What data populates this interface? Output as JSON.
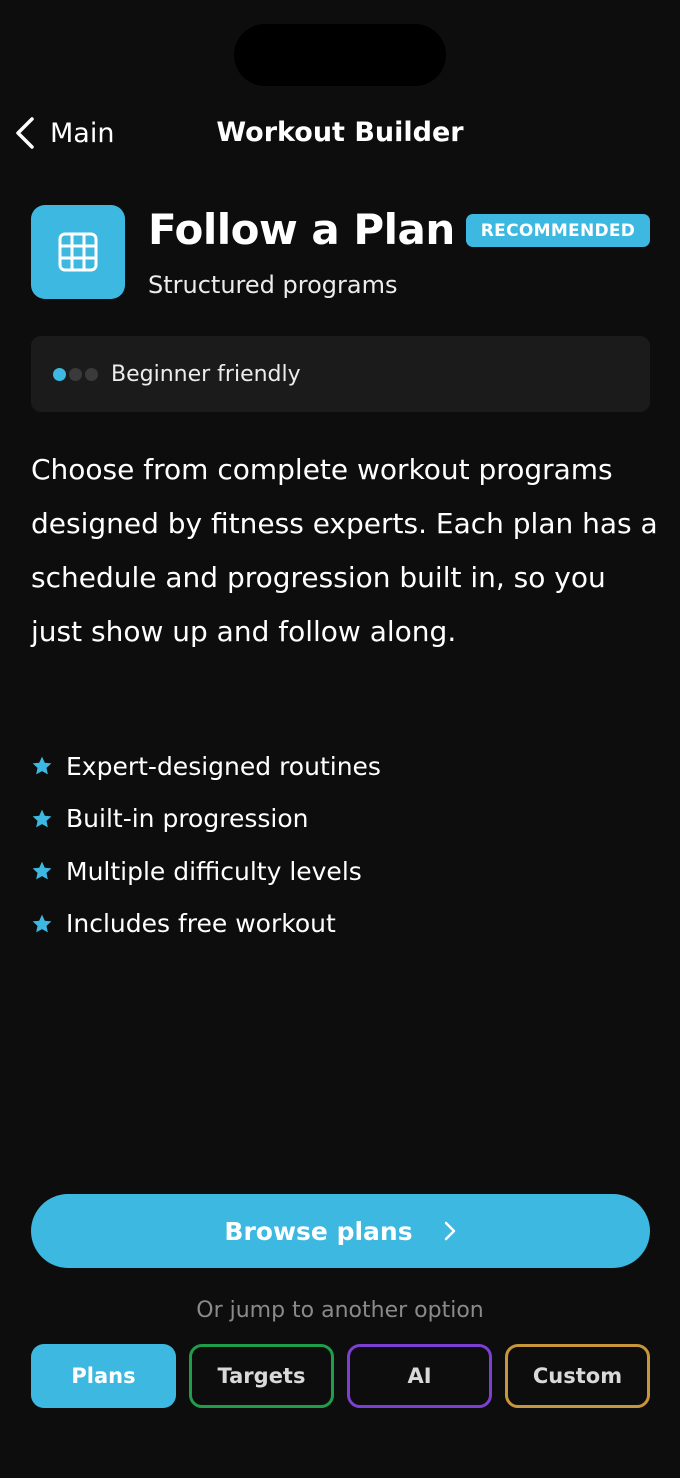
{
  "header": {
    "back_label": "Main",
    "title": "Workout Builder"
  },
  "plan": {
    "icon": "grid-icon",
    "title": "Follow a Plan",
    "badge": "RECOMMENDED",
    "subtitle": "Structured programs",
    "difficulty": {
      "label": "Beginner friendly",
      "level": 1,
      "max_level": 3
    },
    "description": "Choose from complete workout programs designed by fitness experts. Each plan has a schedule and progression built in, so you just show up and follow along.",
    "features": [
      "Expert-designed routines",
      "Built-in progression",
      "Multiple difficulty levels",
      "Includes free workout"
    ]
  },
  "cta": {
    "label": "Browse plans",
    "icon": "chevron-right-icon"
  },
  "jump": {
    "label": "Or jump to another option",
    "options": [
      "Plans",
      "Targets",
      "AI",
      "Custom"
    ],
    "selected": "Plans"
  },
  "colors": {
    "accent": "#3db8e0",
    "background": "#0d0d0d",
    "card": "#1b1b1b",
    "targets_border": "#1f9d4a",
    "ai_border": "#7b3fd1",
    "custom_border": "#c7963c"
  }
}
